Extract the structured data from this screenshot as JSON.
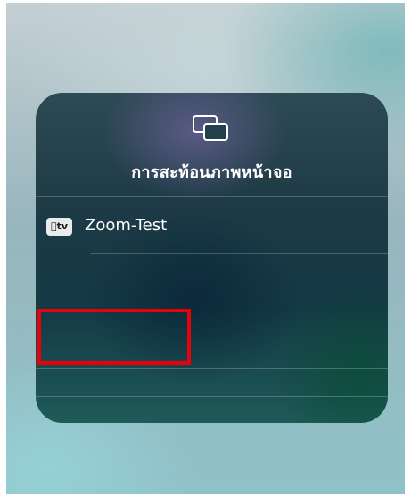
{
  "screen_mirroring_panel": {
    "icon": "screen-mirroring-icon",
    "title": "การสะท้อนภาพหน้าจอ",
    "devices": [
      {
        "badge_icon": "apple-tv-icon",
        "badge_text": "tv",
        "name": "Zoom-Test"
      }
    ]
  },
  "annotation": {
    "highlight_color": "#e8000b"
  },
  "colors": {
    "panel_text": "#ffffff",
    "divider": "rgba(255,255,255,0.22)"
  }
}
